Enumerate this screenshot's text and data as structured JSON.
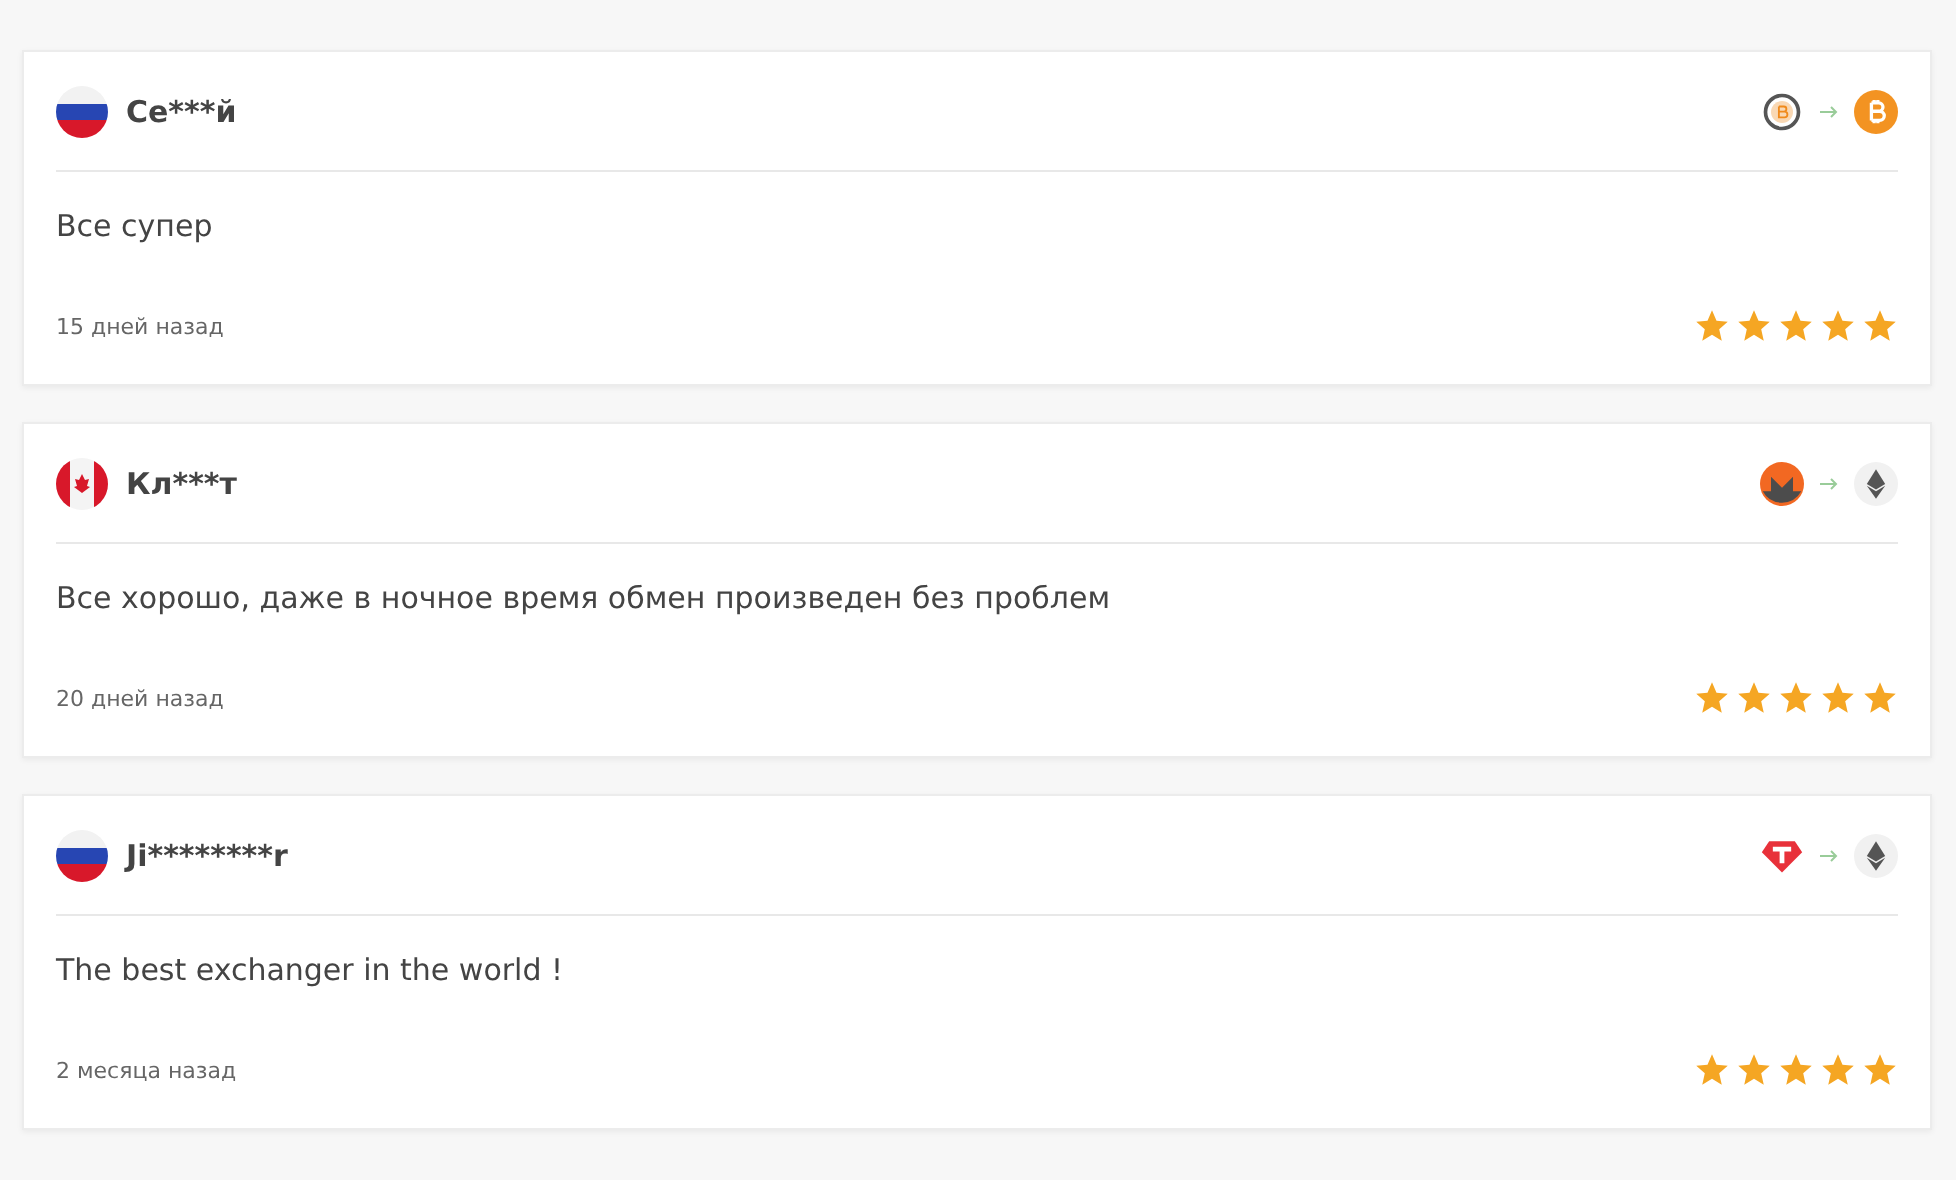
{
  "reviews": [
    {
      "name": "Се***й",
      "flag": {
        "kind": "russia"
      },
      "coins": [
        {
          "kind": "bitcoin-outline"
        },
        {
          "kind": "bitcoin"
        }
      ],
      "text": "Все супер",
      "date": "15 дней назад",
      "stars": 5
    },
    {
      "name": "Кл***т",
      "flag": {
        "kind": "canada"
      },
      "coins": [
        {
          "kind": "monero"
        },
        {
          "kind": "ethereum"
        }
      ],
      "text": "Все хорошо, даже в ночное время обмен произведен без проблем",
      "date": "20 дней назад",
      "stars": 5
    },
    {
      "name": "Ji********r",
      "flag": {
        "kind": "russia"
      },
      "coins": [
        {
          "kind": "tether"
        },
        {
          "kind": "ethereum"
        }
      ],
      "text": "The best exchanger in the world !",
      "date": "2 месяца назад",
      "stars": 5
    }
  ]
}
